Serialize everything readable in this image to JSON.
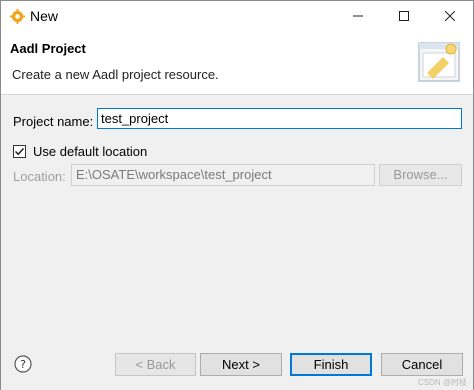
{
  "window": {
    "title": "New",
    "app_icon": "eclipse-gear-icon",
    "controls": {
      "minimize_icon": "minimize-icon",
      "maximize_icon": "maximize-icon",
      "close_icon": "close-icon"
    }
  },
  "header": {
    "title": "Aadl Project",
    "description": "Create a new Aadl project resource.",
    "image_icon": "new-project-wizard-icon"
  },
  "form": {
    "project_name_label": "Project name:",
    "project_name_value": "test_project",
    "use_default_location_label": "Use default location",
    "use_default_location_checked": true,
    "location_label": "Location:",
    "location_value": "E:\\OSATE\\workspace\\test_project",
    "browse_label": "Browse..."
  },
  "footer": {
    "help_icon": "help-icon",
    "back_label": "< Back",
    "next_label": "Next >",
    "finish_label": "Finish",
    "cancel_label": "Cancel"
  },
  "watermark": "CSDN @时枝",
  "colors": {
    "focus_accent": "#0078d7",
    "dialog_bg": "#f0f0f0",
    "header_bg": "#ffffff"
  }
}
